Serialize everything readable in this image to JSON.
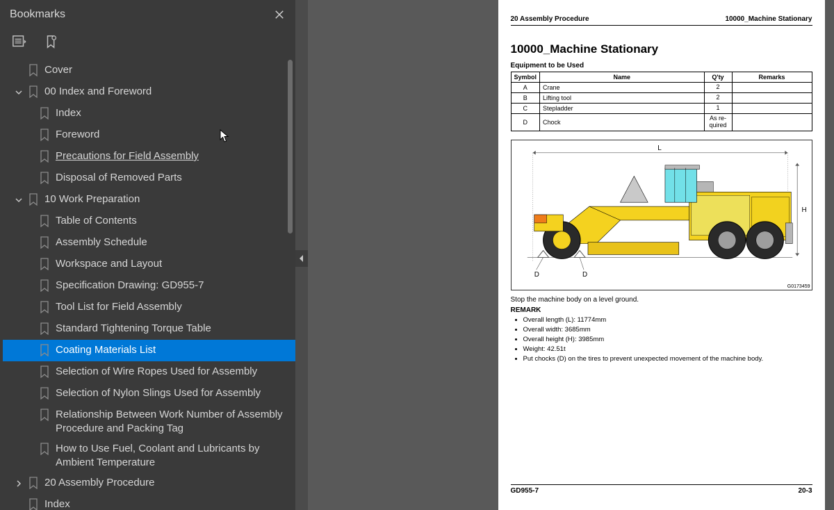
{
  "sidebar": {
    "title": "Bookmarks",
    "tree": [
      {
        "id": "cover",
        "indent": 32,
        "chev": "none",
        "label": "Cover"
      },
      {
        "id": "i0",
        "indent": 14,
        "chev": "down",
        "label": "00 Index and Foreword"
      },
      {
        "id": "index1",
        "indent": 48,
        "chev": "none",
        "label": "Index"
      },
      {
        "id": "foreword",
        "indent": 48,
        "chev": "none",
        "label": "Foreword"
      },
      {
        "id": "precautions",
        "indent": 48,
        "chev": "none",
        "label": "Precautions for Field Assembly",
        "underline": true
      },
      {
        "id": "disposal",
        "indent": 48,
        "chev": "none",
        "label": "Disposal of Removed Parts"
      },
      {
        "id": "i10",
        "indent": 14,
        "chev": "down",
        "label": "10 Work Preparation"
      },
      {
        "id": "toc",
        "indent": 48,
        "chev": "none",
        "label": "Table of Contents"
      },
      {
        "id": "sched",
        "indent": 48,
        "chev": "none",
        "label": "Assembly Schedule"
      },
      {
        "id": "wl",
        "indent": 48,
        "chev": "none",
        "label": "Workspace and Layout"
      },
      {
        "id": "spec",
        "indent": 48,
        "chev": "none",
        "label": "Specification Drawing: GD955-7"
      },
      {
        "id": "tool",
        "indent": 48,
        "chev": "none",
        "label": "Tool List for Field Assembly"
      },
      {
        "id": "torque",
        "indent": 48,
        "chev": "none",
        "label": "Standard Tightening Torque Table"
      },
      {
        "id": "coating",
        "indent": 48,
        "chev": "none",
        "label": "Coating Materials List",
        "selected": true
      },
      {
        "id": "wire",
        "indent": 48,
        "chev": "none",
        "label": "Selection of Wire Ropes Used for Assembly"
      },
      {
        "id": "nylon",
        "indent": 48,
        "chev": "none",
        "label": "Selection of Nylon Slings Used for Assembly"
      },
      {
        "id": "rel",
        "indent": 48,
        "chev": "none",
        "label": " Relationship Between Work Number of Assembly Procedure and Packing Tag"
      },
      {
        "id": "fuel",
        "indent": 48,
        "chev": "none",
        "label": " How to Use Fuel, Coolant and Lubricants by Ambient Temperature"
      },
      {
        "id": "i20",
        "indent": 14,
        "chev": "right",
        "label": "20 Assembly Procedure"
      },
      {
        "id": "index2",
        "indent": 32,
        "chev": "none",
        "label": "Index"
      }
    ]
  },
  "page": {
    "header_left": "20 Assembly Procedure",
    "header_right": "10000_Machine Stationary",
    "title": "10000_Machine Stationary",
    "equip_header": "Equipment to be Used",
    "cols": {
      "sym": "Symbol",
      "name": "Name",
      "qty": "Q'ty",
      "rem": "Remarks"
    },
    "rows": [
      {
        "sym": "A",
        "name": "Crane",
        "qty": "2",
        "rem": ""
      },
      {
        "sym": "B",
        "name": "Lifting tool",
        "qty": "2",
        "rem": ""
      },
      {
        "sym": "C",
        "name": "Stepladder",
        "qty": "1",
        "rem": ""
      },
      {
        "sym": "D",
        "name": "Chock",
        "qty": "As required",
        "rem": ""
      }
    ],
    "diagram_labels": {
      "L": "L",
      "H": "H",
      "D1": "D",
      "D2": "D",
      "id": "G0173459"
    },
    "note": "Stop the machine body on a level ground.",
    "remark_head": "REMARK",
    "remarks": [
      "Overall length (L): 11774mm",
      "Overall width: 3685mm",
      "Overall height (H): 3985mm",
      "Weight: 42.51t",
      "Put chocks (D) on the tires to prevent unexpected movement of the machine body."
    ],
    "footer_left": "GD955-7",
    "footer_right": "20-3"
  }
}
